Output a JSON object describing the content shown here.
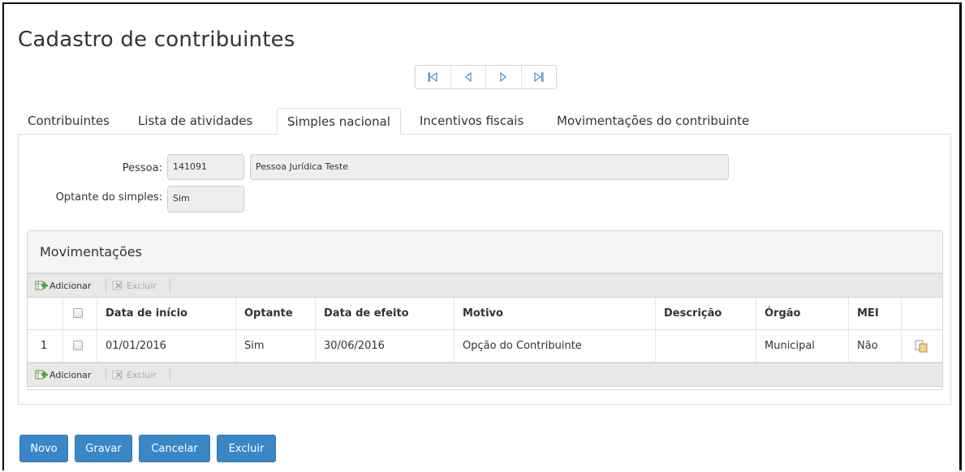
{
  "page": {
    "title": "Cadastro de contribuintes"
  },
  "pager": {
    "buttons": [
      "first-icon",
      "previous-icon",
      "next-icon",
      "last-icon"
    ]
  },
  "tabs": [
    {
      "label": "Contribuintes",
      "active": false
    },
    {
      "label": "Lista de atividades",
      "active": false
    },
    {
      "label": "Simples nacional",
      "active": true
    },
    {
      "label": "Incentivos fiscais",
      "active": false
    },
    {
      "label": "Movimentações do contribuinte",
      "active": false
    }
  ],
  "form": {
    "pessoa_label": "Pessoa:",
    "pessoa_code": "141091",
    "pessoa_name": "Pessoa Jurídica Teste",
    "optante_label": "Optante do simples:",
    "optante_value": "Sim"
  },
  "movimentacoes": {
    "title": "Movimentações",
    "toolbar": {
      "add_label": "Adicionar",
      "delete_label": "Excluir"
    },
    "columns": [
      "Data de início",
      "Optante",
      "Data de efeito",
      "Motivo",
      "Descrição",
      "Órgão",
      "MEI"
    ],
    "rows": [
      {
        "index": "1",
        "data_inicio": "01/01/2016",
        "optante": "Sim",
        "data_efeito": "30/06/2016",
        "motivo": "Opção do Contribuinte",
        "descricao": "",
        "orgao": "Municipal",
        "mei": "Não"
      }
    ]
  },
  "actions": {
    "novo": "Novo",
    "gravar": "Gravar",
    "cancelar": "Cancelar",
    "excluir": "Excluir"
  },
  "colors": {
    "primary_button": "#3a87c8",
    "field_bg": "#eeeeee",
    "grid_header_bg": "#f5f5f5",
    "toolbar_bg": "#e8e8e8"
  }
}
